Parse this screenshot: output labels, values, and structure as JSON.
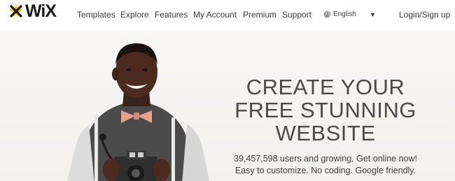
{
  "brand": {
    "logo_text": "WiX",
    "accent_color": "#f6c20d"
  },
  "nav": {
    "items": [
      "Templates",
      "Explore",
      "Features",
      "My Account",
      "Premium",
      "Support"
    ],
    "language": "English",
    "login": "Login/Sign up"
  },
  "hero": {
    "headline": [
      "CREATE YOUR",
      "FREE STUNNING",
      "WEBSITE"
    ],
    "subtext": [
      "39,457,598 users and growing. Get online now!",
      "Easy to customize. No coding. Google friendly."
    ]
  }
}
